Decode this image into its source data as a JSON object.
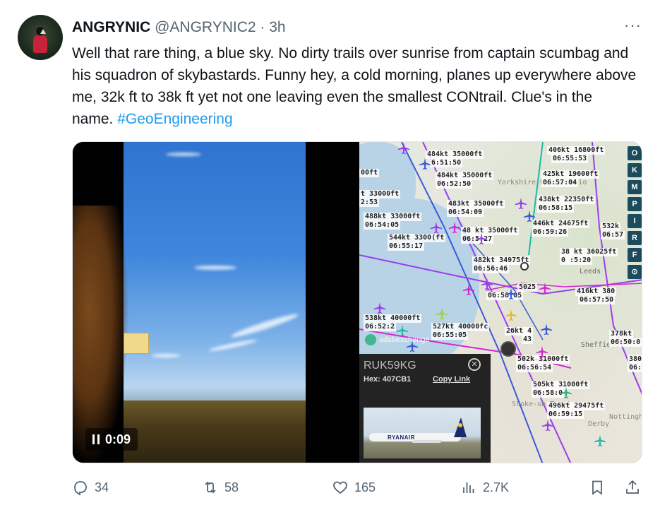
{
  "author": {
    "display_name": "ANGRYNIC",
    "handle": "@ANGRYNIC2",
    "time": " · 3h"
  },
  "more_label": "···",
  "tweet": {
    "text": "Well that rare thing, a blue sky. No dirty trails over sunrise from captain scumbag and his squadron of skybastards. Funny hey, a cold morning, planes up everywhere above me, 32k ft to 38k ft yet not one leaving even the smallest CONtrail. Clue's in the name. ",
    "hashtag": "#GeoEngineering"
  },
  "video": {
    "timestamp": "0:09"
  },
  "map": {
    "labels": [
      "484kt 35000ft",
      "6:51:50",
      "00ft",
      "484kt 35000ft",
      "06:52:50",
      "t 33000ft",
      "2:53",
      "483kt 35000ft",
      "06:54:09",
      "488kt 33000ft",
      "06:54:05",
      "544kt 3300(ft",
      "06:55:17",
      "48 kt 35000ft",
      "06:5 27",
      "482kt 34975ft",
      "06:56:46",
      "5025",
      "06:58:05",
      "538kt 40000ft",
      "06:52:2",
      "527kt 40000fc",
      "06:55:05",
      "26kt 4",
      "43",
      "406kt 16800ft",
      "06:55:53",
      "425kt 19600ft",
      "06:57:04",
      "438kt 22350ft",
      "06:58:15",
      "446kt 24675ft",
      "06:59:26",
      "532k",
      "06:57",
      "38 kt 36025ft",
      "0 :5:20",
      "416kt 380",
      "06:57:50",
      "378kt",
      "06:50:0",
      "502k 31000ft",
      "06:56:54",
      "505kt 31000ft",
      "06:58:0",
      "496kt 29475ft",
      "06:59:15",
      "380",
      "06:"
    ],
    "sidebar_buttons": [
      "O",
      "K",
      "M",
      "P",
      "I",
      "R",
      "F"
    ],
    "watermark": "adsbexchange",
    "place_names": [
      "Yorkshire Dales Natio",
      "Leeds",
      "Sheffield",
      "Stoke-on-Trent",
      "Derby",
      "Nottingham"
    ],
    "popup": {
      "registration": "RUK59KG",
      "hex_label": "Hex: ",
      "hex_value": "407CB1",
      "copy_link": "Copy Link",
      "livery": "RYANAIR"
    }
  },
  "actions": {
    "replies": "34",
    "reposts": "58",
    "likes": "165",
    "views": "2.7K"
  },
  "colors": {
    "hashtag": "#1d9bf0",
    "secondary_text": "#536471",
    "track_purple": "#9b3cf0",
    "track_magenta": "#d12ad1",
    "track_blue": "#3c5ad8",
    "track_teal": "#1fb7a8"
  }
}
